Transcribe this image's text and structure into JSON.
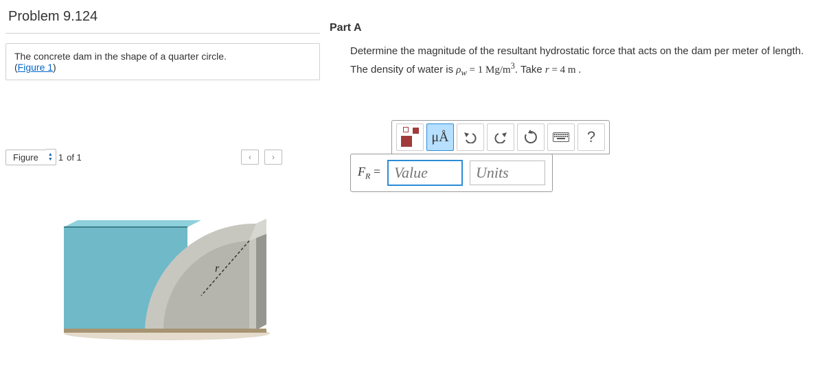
{
  "problem": {
    "title": "Problem 9.124",
    "description": "The concrete dam in the shape of a quarter circle.",
    "figure_link_text": "Figure 1"
  },
  "figure_nav": {
    "label": "Figure",
    "current": "1",
    "of_text": "of 1",
    "prev": "‹",
    "next": "›"
  },
  "diagram": {
    "radius_label": "r"
  },
  "partA": {
    "heading": "Part A",
    "question_part1": "Determine the magnitude of the resultant hydrostatic force that acts on the dam per meter of length. The density of water is ",
    "rho_sym": "ρ",
    "rho_sub": "w",
    "density_eq": " = 1 Mg/m",
    "density_sup": "3",
    "take_text": ". Take ",
    "r_sym": "r",
    "r_eq": " = 4 m ."
  },
  "toolbar": {
    "template_tooltip": "templates",
    "special_chars": "μÅ",
    "help": "?"
  },
  "answer": {
    "lhs_main": "F",
    "lhs_sub": "R",
    "equals": " = ",
    "value_placeholder": "Value",
    "units_placeholder": "Units"
  }
}
